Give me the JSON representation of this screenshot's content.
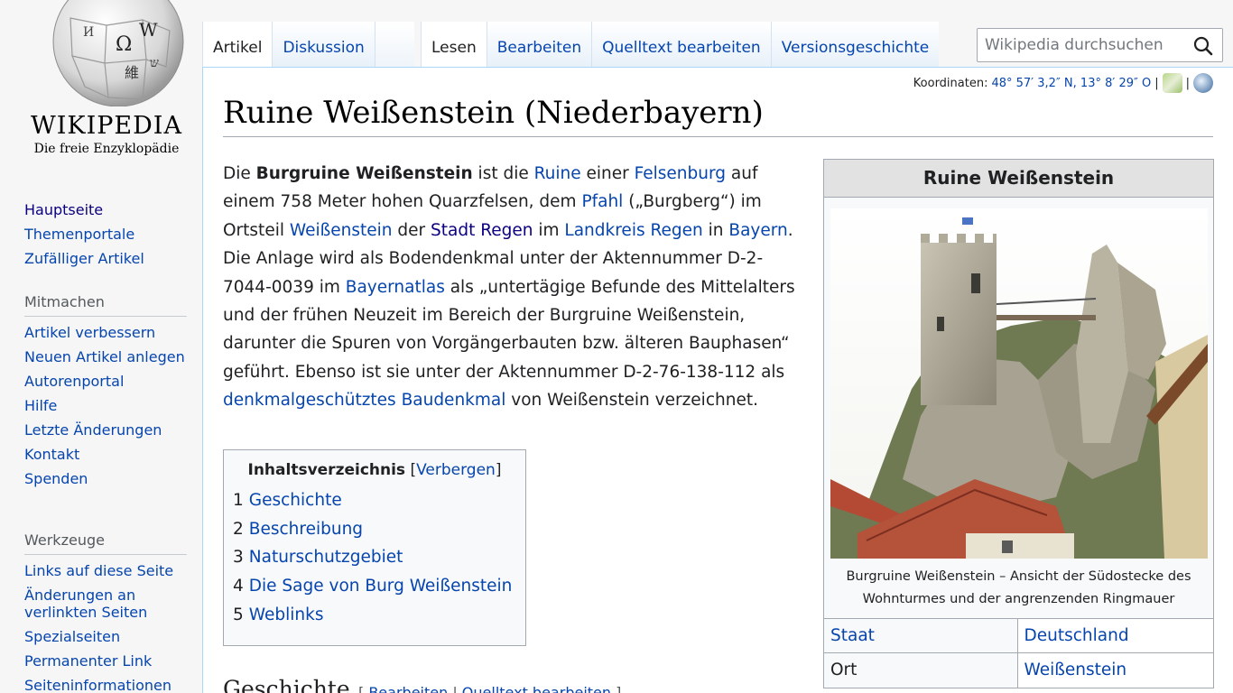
{
  "logo": {
    "wordmark": "WIKIPEDIA",
    "tagline": "Die freie Enzyklopädie"
  },
  "nav": {
    "main": [
      {
        "label": "Hauptseite",
        "visited": true
      },
      {
        "label": "Themenportale"
      },
      {
        "label": "Zufälliger Artikel"
      }
    ],
    "mitmachen": {
      "heading": "Mitmachen",
      "items": [
        {
          "label": "Artikel verbessern"
        },
        {
          "label": "Neuen Artikel anlegen"
        },
        {
          "label": "Autorenportal"
        },
        {
          "label": "Hilfe"
        },
        {
          "label": "Letzte Änderungen"
        },
        {
          "label": "Kontakt"
        },
        {
          "label": "Spenden"
        }
      ]
    },
    "werkzeuge": {
      "heading": "Werkzeuge",
      "items": [
        {
          "label": "Links auf diese Seite"
        },
        {
          "label": "Änderungen an verlinkten Seiten"
        },
        {
          "label": "Spezialseiten"
        },
        {
          "label": "Permanenter Link"
        },
        {
          "label": "Seiteninformationen"
        }
      ]
    }
  },
  "tabs": {
    "left": [
      {
        "label": "Artikel",
        "selected": true
      },
      {
        "label": "Diskussion"
      }
    ],
    "right": [
      {
        "label": "Lesen",
        "selected": true
      },
      {
        "label": "Bearbeiten"
      },
      {
        "label": "Quelltext bearbeiten"
      },
      {
        "label": "Versionsgeschichte"
      }
    ]
  },
  "search": {
    "placeholder": "Wikipedia durchsuchen"
  },
  "coordinates": {
    "label": "Koordinaten:",
    "value": "48° 57′ 3,2″ N, 13° 8′ 29″ O"
  },
  "article": {
    "title": "Ruine Weißenstein (Niederbayern)",
    "lead": [
      {
        "t": "Die "
      },
      {
        "t": "Burgruine Weißenstein",
        "b": true
      },
      {
        "t": " ist die "
      },
      {
        "t": "Ruine",
        "link": true
      },
      {
        "t": " einer "
      },
      {
        "t": "Felsenburg",
        "link": true
      },
      {
        "t": " auf einem 758 Meter hohen Quarzfelsen, dem "
      },
      {
        "t": "Pfahl",
        "link": true
      },
      {
        "t": " („Burgberg“) im Ortsteil "
      },
      {
        "t": "Weißenstein",
        "link": true
      },
      {
        "t": " der "
      },
      {
        "t": "Stadt Regen",
        "link": true,
        "visited": true
      },
      {
        "t": " im "
      },
      {
        "t": "Landkreis Regen",
        "link": true
      },
      {
        "t": " in "
      },
      {
        "t": "Bayern",
        "link": true
      },
      {
        "t": ". Die Anlage wird als Bodendenkmal unter der Aktennummer D-2-7044-0039 im "
      },
      {
        "t": "Bayernatlas",
        "link": true
      },
      {
        "t": " als „untertägige Befunde des Mittelalters und der frühen Neuzeit im Bereich der Burgruine Weißenstein, darunter die Spuren von Vorgängerbauten bzw. älteren Bauphasen“ geführt. Ebenso ist sie unter der Aktennummer D-2-76-138-112 als "
      },
      {
        "t": "denkmalgeschütztes Baudenkmal",
        "link": true
      },
      {
        "t": " von Weißenstein verzeichnet."
      }
    ],
    "toc": {
      "title": "Inhaltsverzeichnis",
      "toggle": "Verbergen",
      "items": [
        {
          "num": "1",
          "label": "Geschichte"
        },
        {
          "num": "2",
          "label": "Beschreibung"
        },
        {
          "num": "3",
          "label": "Naturschutzgebiet"
        },
        {
          "num": "4",
          "label": "Die Sage von Burg Weißenstein"
        },
        {
          "num": "5",
          "label": "Weblinks"
        }
      ]
    },
    "section": {
      "heading": "Geschichte",
      "edit": "Bearbeiten",
      "source_edit": "Quelltext bearbeiten"
    }
  },
  "infobox": {
    "title": "Ruine Weißenstein",
    "caption": "Burgruine Weißenstein – Ansicht der Südostecke des Wohnturmes und der angrenzenden Ringmauer",
    "rows": [
      {
        "key": "Staat",
        "key_link": true,
        "value": "Deutschland"
      },
      {
        "key": "Ort",
        "key_link": false,
        "value": "Weißenstein"
      }
    ]
  }
}
